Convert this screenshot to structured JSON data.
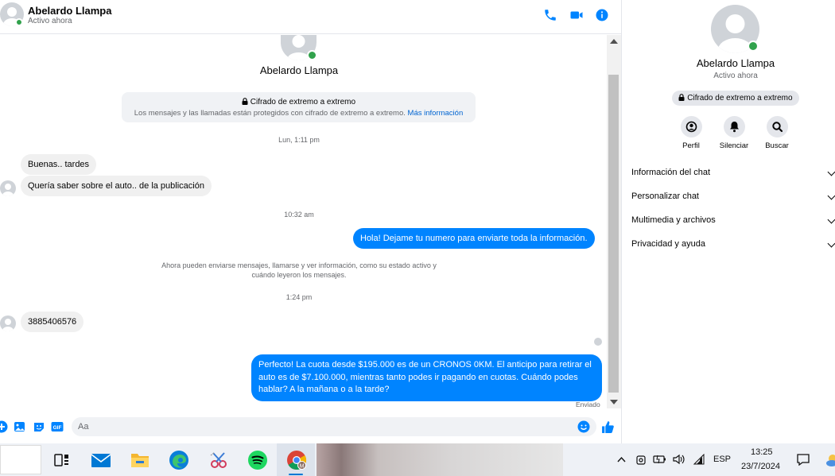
{
  "header": {
    "name": "Abelardo Llampa",
    "status": "Activo ahora",
    "icons": [
      "phone-icon",
      "video-icon",
      "info-icon"
    ]
  },
  "conversation": {
    "contact_name": "Abelardo Llampa",
    "e2e_title": "Cifrado de extremo a extremo",
    "e2e_text": "Los mensajes y las llamadas están protegidos con cifrado de extremo a extremo.",
    "e2e_link": "Más información",
    "timestamps": [
      "Lun, 1:11 pm",
      "10:32 am",
      "1:24 pm"
    ],
    "incoming": [
      "Buenas.. tardes",
      "Quería saber sobre el auto.. de la publicación",
      "3885406576"
    ],
    "outgoing": [
      "Hola! Dejame tu numero  para enviarte toda la información.",
      "Perfecto! La cuota desde $195.000 es de un CRONOS 0KM. El anticipo para retirar el auto es de $7.100.000, mientras tanto podes ir pagando en cuotas. Cuándo podes hablar? A la mañana o a la tarde?"
    ],
    "system_note": "Ahora pueden enviarse mensajes, llamarse y ver información, como su estado activo y cuándo leyeron los mensajes.",
    "sent_label": "Enviado"
  },
  "composer": {
    "placeholder": "Aa",
    "icons": [
      "plus-icon",
      "image-icon",
      "sticker-icon",
      "gif-icon",
      "emoji-icon",
      "like-icon"
    ],
    "gif_label": "GIF"
  },
  "right_panel": {
    "name": "Abelardo Llampa",
    "status": "Activo ahora",
    "e2e_badge": "Cifrado de extremo a extremo",
    "actions": [
      {
        "label": "Perfil",
        "icon": "profile-icon"
      },
      {
        "label": "Silenciar",
        "icon": "bell-icon"
      },
      {
        "label": "Buscar",
        "icon": "search-icon"
      }
    ],
    "menu": [
      "Información del chat",
      "Personalizar chat",
      "Multimedia y archivos",
      "Privacidad y ayuda"
    ]
  },
  "taskbar": {
    "apps": [
      "task-view-icon",
      "mail-icon",
      "file-explorer-icon",
      "edge-icon",
      "snipping-tool-icon",
      "spotify-icon",
      "chrome-icon"
    ],
    "tray": {
      "language": "ESP",
      "time": "13:25",
      "date": "23/7/2024"
    }
  },
  "colors": {
    "accent": "#0084ff",
    "online": "#31a24c",
    "link": "#0064d1"
  }
}
